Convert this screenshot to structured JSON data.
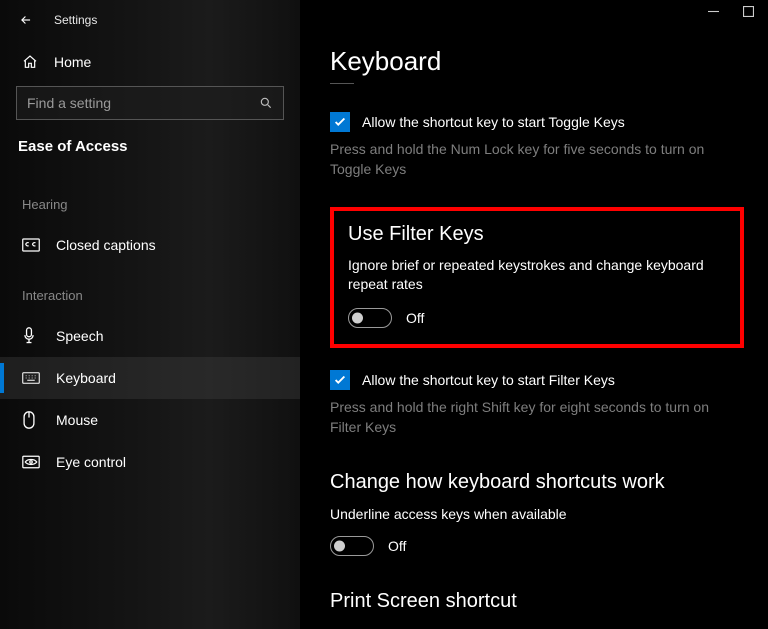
{
  "titlebar": {
    "label": "Settings"
  },
  "sidebar": {
    "home": "Home",
    "search_placeholder": "Find a setting",
    "header": "Ease of Access",
    "groups": [
      {
        "label": "Hearing",
        "items": [
          {
            "label": "Closed captions"
          }
        ]
      },
      {
        "label": "Interaction",
        "items": [
          {
            "label": "Speech"
          },
          {
            "label": "Keyboard"
          },
          {
            "label": "Mouse"
          },
          {
            "label": "Eye control"
          }
        ]
      }
    ]
  },
  "main": {
    "title": "Keyboard",
    "toggleKeys": {
      "checkbox_label": "Allow the shortcut key to start Toggle Keys",
      "help": "Press and hold the Num Lock key for five seconds to turn on Toggle Keys"
    },
    "filterKeys": {
      "title": "Use Filter Keys",
      "desc": "Ignore brief or repeated keystrokes and change keyboard repeat rates",
      "state": "Off",
      "checkbox_label": "Allow the shortcut key to start Filter Keys",
      "help": "Press and hold the right Shift key for eight seconds to turn on Filter Keys"
    },
    "shortcuts": {
      "title": "Change how keyboard shortcuts work",
      "option": "Underline access keys when available",
      "state": "Off"
    },
    "printscreen": {
      "title": "Print Screen shortcut"
    }
  }
}
